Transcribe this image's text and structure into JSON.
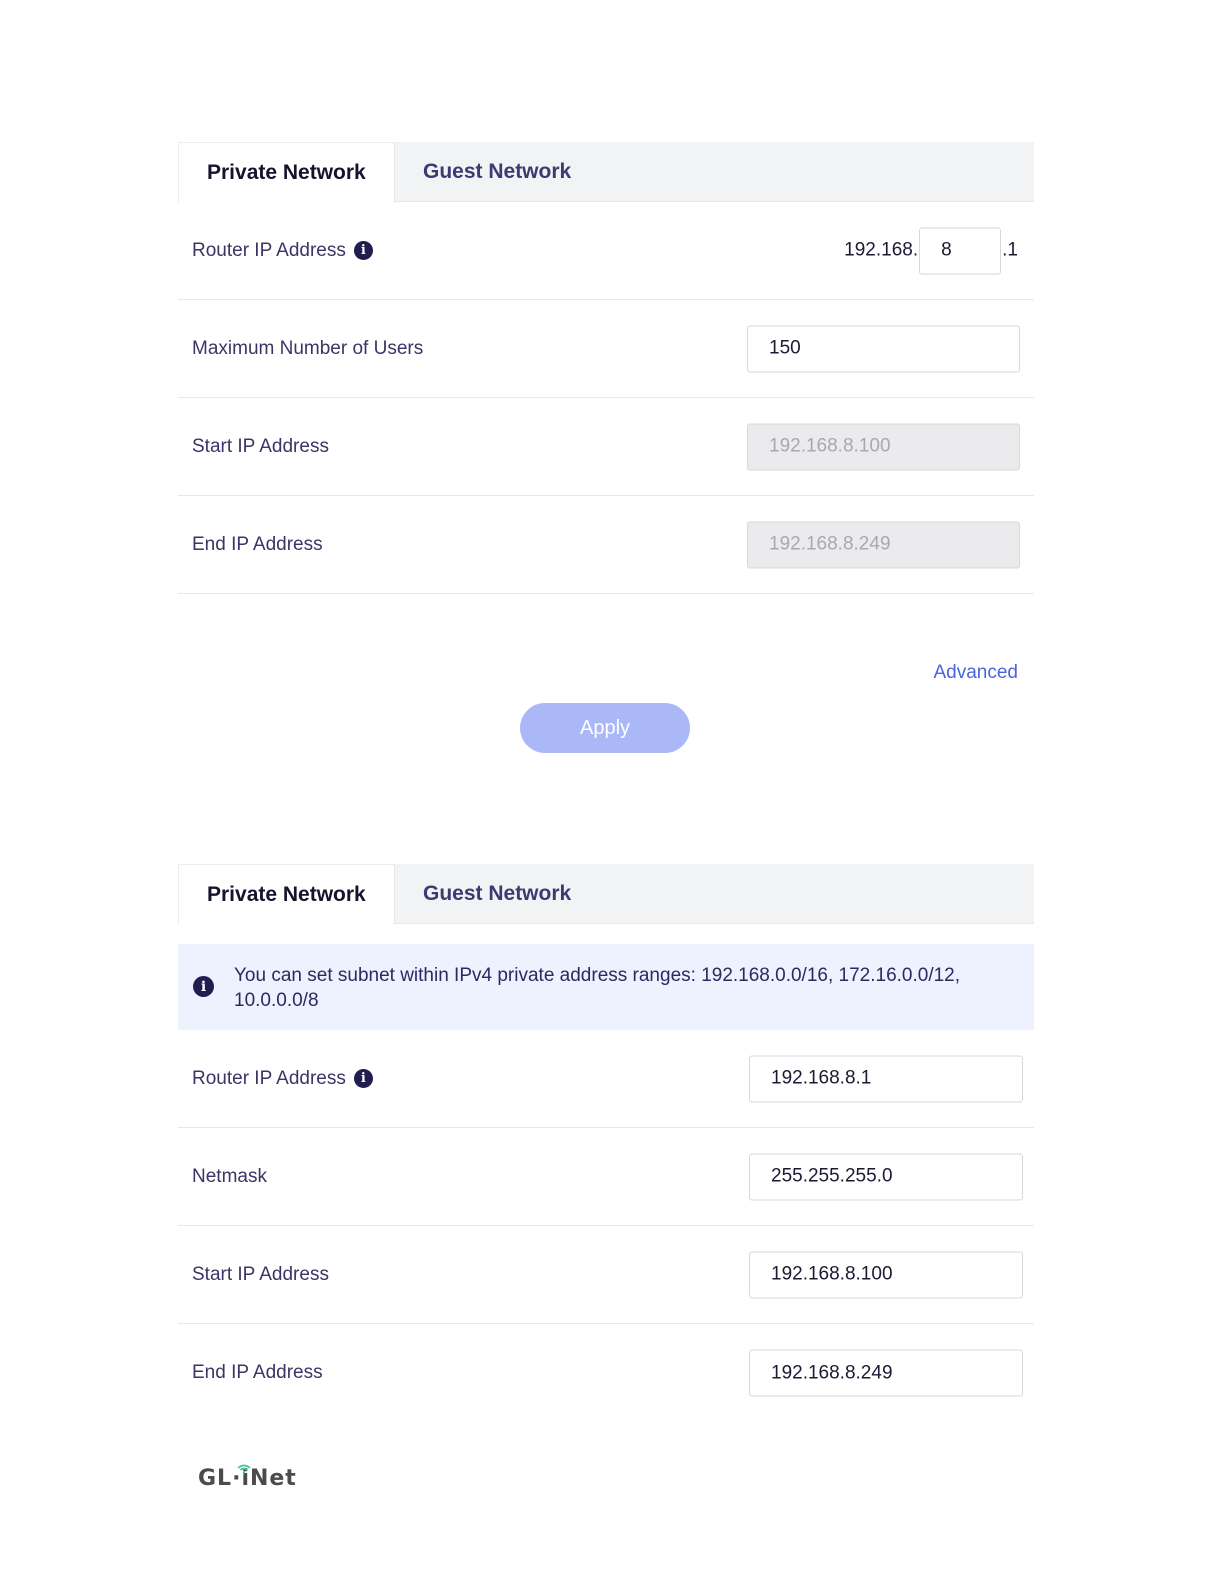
{
  "panel1": {
    "tabs": {
      "private": "Private Network",
      "guest": "Guest Network"
    },
    "router_ip": {
      "label": "Router IP Address",
      "prefix": "192.168.",
      "octet": "8",
      "suffix": ".1"
    },
    "max_users": {
      "label": "Maximum Number of Users",
      "value": "150"
    },
    "start_ip": {
      "label": "Start IP Address",
      "value": "192.168.8.100"
    },
    "end_ip": {
      "label": "End IP Address",
      "value": "192.168.8.249"
    },
    "advanced_label": "Advanced",
    "apply_label": "Apply"
  },
  "panel2": {
    "tabs": {
      "private": "Private Network",
      "guest": "Guest Network"
    },
    "notice": "You can set subnet within IPv4 private address ranges: 192.168.0.0/16, 172.16.0.0/12, 10.0.0.0/8",
    "router_ip": {
      "label": "Router IP Address",
      "value": "192.168.8.1"
    },
    "netmask": {
      "label": "Netmask",
      "value": "255.255.255.0"
    },
    "start_ip": {
      "label": "Start IP Address",
      "value": "192.168.8.100"
    },
    "end_ip": {
      "label": "End IP Address",
      "value": "192.168.8.249"
    }
  },
  "logo": {
    "text_left": "GL·",
    "text_right": "iNet"
  },
  "icons": {
    "info": "info-icon",
    "wifi": "wifi-icon"
  },
  "colors": {
    "accent": "#4a63e0",
    "apply_disabled": "#aab8f7",
    "notice_bg": "#eef1fe",
    "wifi": "#3fc5a0"
  }
}
